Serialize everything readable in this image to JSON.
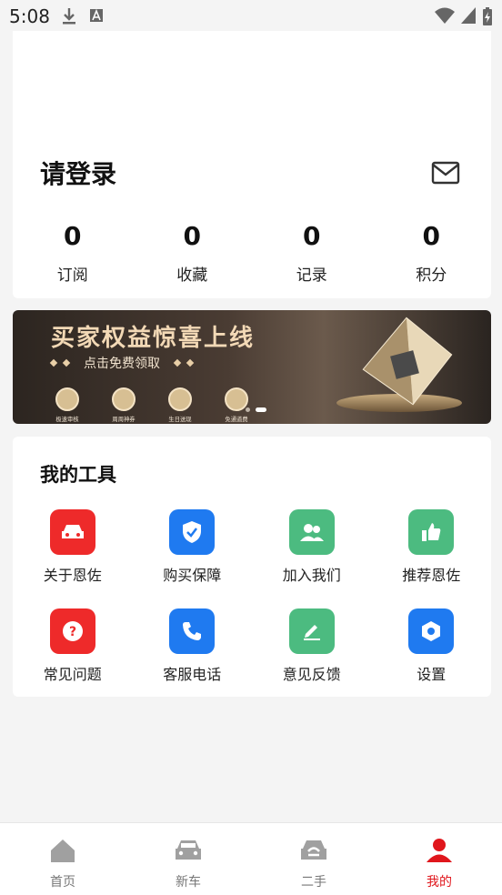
{
  "status_bar": {
    "time": "5:08"
  },
  "profile": {
    "login_title": "请登录",
    "stats": [
      {
        "value": "0",
        "label": "订阅"
      },
      {
        "value": "0",
        "label": "收藏"
      },
      {
        "value": "0",
        "label": "记录"
      },
      {
        "value": "0",
        "label": "积分"
      }
    ]
  },
  "banner": {
    "title": "买家权益惊喜上线",
    "subtitle": "点击免费领取",
    "perks": [
      "极速审核",
      "周周神券",
      "生日送现",
      "免通道费"
    ]
  },
  "tools": {
    "title": "我的工具",
    "items": [
      {
        "label": "关于恩佐",
        "icon": "car-icon",
        "color": "#ee2a2a"
      },
      {
        "label": "购买保障",
        "icon": "shield-check-icon",
        "color": "#1f7af0"
      },
      {
        "label": "加入我们",
        "icon": "users-icon",
        "color": "#4cbb80"
      },
      {
        "label": "推荐恩佐",
        "icon": "thumbs-up-icon",
        "color": "#4cbb80"
      },
      {
        "label": "常见问题",
        "icon": "question-icon",
        "color": "#ee2a2a"
      },
      {
        "label": "客服电话",
        "icon": "phone-icon",
        "color": "#1f7af0"
      },
      {
        "label": "意见反馈",
        "icon": "pen-icon",
        "color": "#4cbb80"
      },
      {
        "label": "设置",
        "icon": "hexagon-settings-icon",
        "color": "#1f7af0"
      }
    ]
  },
  "tabbar": {
    "tabs": [
      {
        "label": "首页",
        "icon": "home-icon",
        "active": false
      },
      {
        "label": "新车",
        "icon": "car-icon",
        "active": false
      },
      {
        "label": "二手",
        "icon": "used-car-icon",
        "active": false
      },
      {
        "label": "我的",
        "icon": "user-icon",
        "active": true
      }
    ]
  },
  "colors": {
    "accent": "#e0161c",
    "inactive": "#a0a0a0"
  }
}
